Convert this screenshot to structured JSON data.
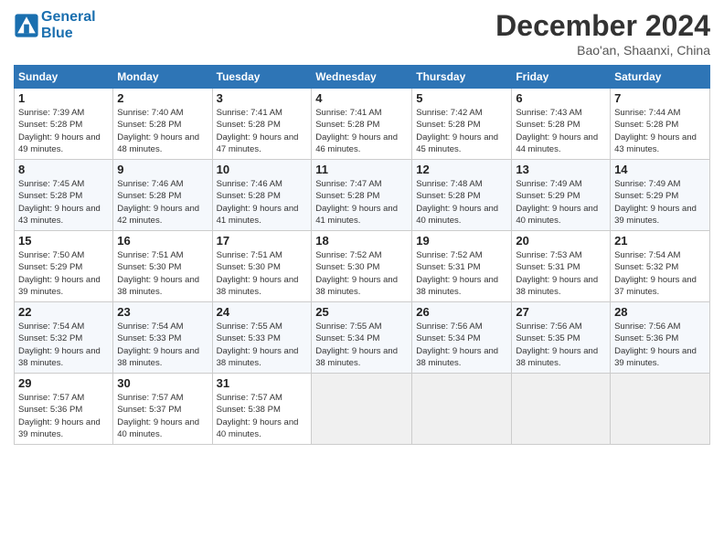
{
  "header": {
    "logo_line1": "General",
    "logo_line2": "Blue",
    "month": "December 2024",
    "location": "Bao'an, Shaanxi, China"
  },
  "weekdays": [
    "Sunday",
    "Monday",
    "Tuesday",
    "Wednesday",
    "Thursday",
    "Friday",
    "Saturday"
  ],
  "weeks": [
    [
      {
        "day": "1",
        "sunrise": "7:39 AM",
        "sunset": "5:28 PM",
        "daylight": "9 hours and 49 minutes."
      },
      {
        "day": "2",
        "sunrise": "7:40 AM",
        "sunset": "5:28 PM",
        "daylight": "9 hours and 48 minutes."
      },
      {
        "day": "3",
        "sunrise": "7:41 AM",
        "sunset": "5:28 PM",
        "daylight": "9 hours and 47 minutes."
      },
      {
        "day": "4",
        "sunrise": "7:41 AM",
        "sunset": "5:28 PM",
        "daylight": "9 hours and 46 minutes."
      },
      {
        "day": "5",
        "sunrise": "7:42 AM",
        "sunset": "5:28 PM",
        "daylight": "9 hours and 45 minutes."
      },
      {
        "day": "6",
        "sunrise": "7:43 AM",
        "sunset": "5:28 PM",
        "daylight": "9 hours and 44 minutes."
      },
      {
        "day": "7",
        "sunrise": "7:44 AM",
        "sunset": "5:28 PM",
        "daylight": "9 hours and 43 minutes."
      }
    ],
    [
      {
        "day": "8",
        "sunrise": "7:45 AM",
        "sunset": "5:28 PM",
        "daylight": "9 hours and 43 minutes."
      },
      {
        "day": "9",
        "sunrise": "7:46 AM",
        "sunset": "5:28 PM",
        "daylight": "9 hours and 42 minutes."
      },
      {
        "day": "10",
        "sunrise": "7:46 AM",
        "sunset": "5:28 PM",
        "daylight": "9 hours and 41 minutes."
      },
      {
        "day": "11",
        "sunrise": "7:47 AM",
        "sunset": "5:28 PM",
        "daylight": "9 hours and 41 minutes."
      },
      {
        "day": "12",
        "sunrise": "7:48 AM",
        "sunset": "5:28 PM",
        "daylight": "9 hours and 40 minutes."
      },
      {
        "day": "13",
        "sunrise": "7:49 AM",
        "sunset": "5:29 PM",
        "daylight": "9 hours and 40 minutes."
      },
      {
        "day": "14",
        "sunrise": "7:49 AM",
        "sunset": "5:29 PM",
        "daylight": "9 hours and 39 minutes."
      }
    ],
    [
      {
        "day": "15",
        "sunrise": "7:50 AM",
        "sunset": "5:29 PM",
        "daylight": "9 hours and 39 minutes."
      },
      {
        "day": "16",
        "sunrise": "7:51 AM",
        "sunset": "5:30 PM",
        "daylight": "9 hours and 38 minutes."
      },
      {
        "day": "17",
        "sunrise": "7:51 AM",
        "sunset": "5:30 PM",
        "daylight": "9 hours and 38 minutes."
      },
      {
        "day": "18",
        "sunrise": "7:52 AM",
        "sunset": "5:30 PM",
        "daylight": "9 hours and 38 minutes."
      },
      {
        "day": "19",
        "sunrise": "7:52 AM",
        "sunset": "5:31 PM",
        "daylight": "9 hours and 38 minutes."
      },
      {
        "day": "20",
        "sunrise": "7:53 AM",
        "sunset": "5:31 PM",
        "daylight": "9 hours and 38 minutes."
      },
      {
        "day": "21",
        "sunrise": "7:54 AM",
        "sunset": "5:32 PM",
        "daylight": "9 hours and 37 minutes."
      }
    ],
    [
      {
        "day": "22",
        "sunrise": "7:54 AM",
        "sunset": "5:32 PM",
        "daylight": "9 hours and 38 minutes."
      },
      {
        "day": "23",
        "sunrise": "7:54 AM",
        "sunset": "5:33 PM",
        "daylight": "9 hours and 38 minutes."
      },
      {
        "day": "24",
        "sunrise": "7:55 AM",
        "sunset": "5:33 PM",
        "daylight": "9 hours and 38 minutes."
      },
      {
        "day": "25",
        "sunrise": "7:55 AM",
        "sunset": "5:34 PM",
        "daylight": "9 hours and 38 minutes."
      },
      {
        "day": "26",
        "sunrise": "7:56 AM",
        "sunset": "5:34 PM",
        "daylight": "9 hours and 38 minutes."
      },
      {
        "day": "27",
        "sunrise": "7:56 AM",
        "sunset": "5:35 PM",
        "daylight": "9 hours and 38 minutes."
      },
      {
        "day": "28",
        "sunrise": "7:56 AM",
        "sunset": "5:36 PM",
        "daylight": "9 hours and 39 minutes."
      }
    ],
    [
      {
        "day": "29",
        "sunrise": "7:57 AM",
        "sunset": "5:36 PM",
        "daylight": "9 hours and 39 minutes."
      },
      {
        "day": "30",
        "sunrise": "7:57 AM",
        "sunset": "5:37 PM",
        "daylight": "9 hours and 40 minutes."
      },
      {
        "day": "31",
        "sunrise": "7:57 AM",
        "sunset": "5:38 PM",
        "daylight": "9 hours and 40 minutes."
      },
      null,
      null,
      null,
      null
    ]
  ]
}
